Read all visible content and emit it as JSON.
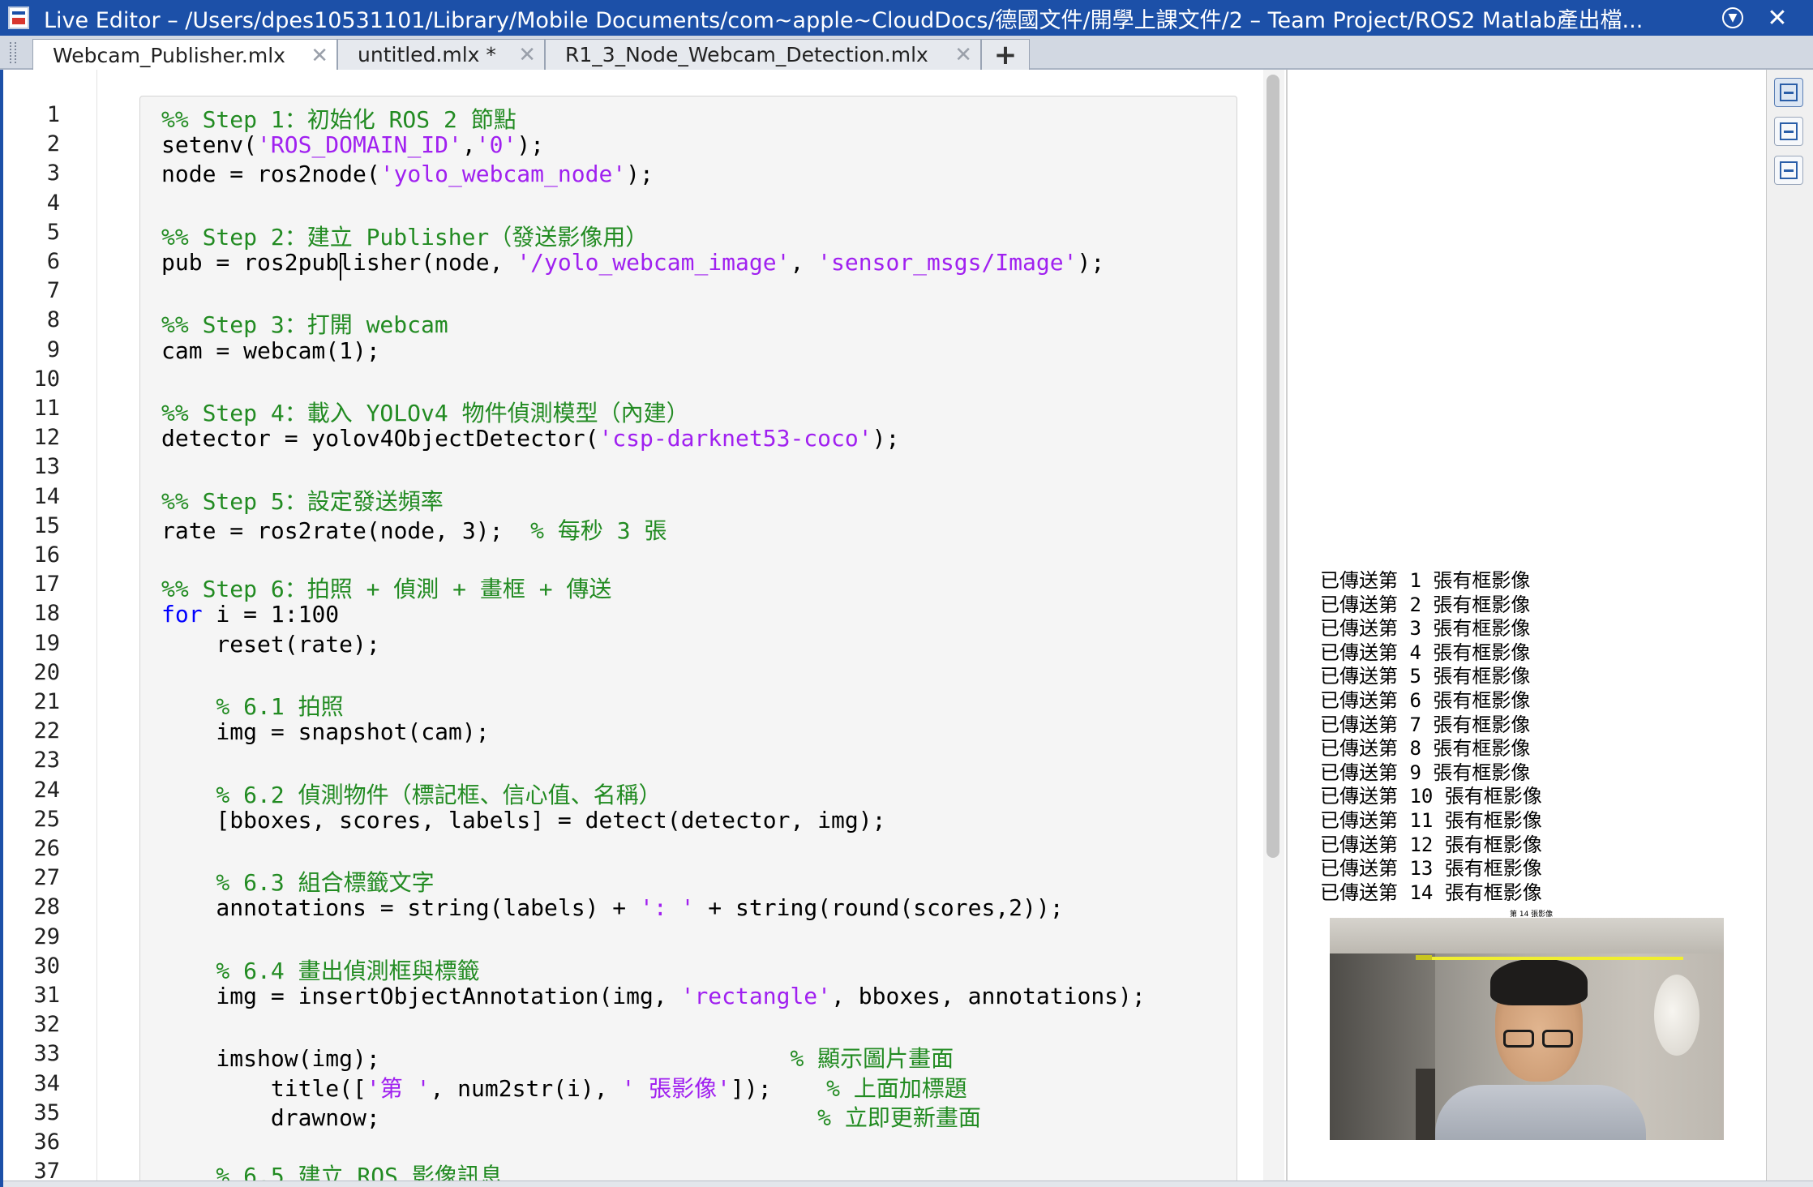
{
  "window": {
    "title": "Live Editor – /Users/dpes10531101/Library/Mobile Documents/com~apple~CloudDocs/德國文件/開學上課文件/2 – Team Project/ROS2 Matlab產出檔...",
    "app_icon": "matlab-live-editor-icon",
    "menu_icon": "circle-chevron-down-icon",
    "close_glyph": "✕"
  },
  "tabs": [
    {
      "label": "Webcam_Publisher.mlx",
      "active": true
    },
    {
      "label": "untitled.mlx *",
      "active": false
    },
    {
      "label": "R1_3_Node_Webcam_Detection.mlx",
      "active": false
    }
  ],
  "tab_close_glyph": "✕",
  "tab_add_glyph": "+",
  "colors": {
    "titlebar": "#1c50a8",
    "comment": "#228b22",
    "string": "#a020f0",
    "keyword": "#0000ff",
    "code_background": "#f5f5f5"
  },
  "code_lines": [
    {
      "n": "1",
      "parts": [
        {
          "t": "%% Step 1：初始化 ROS 2 節點",
          "k": "comment"
        }
      ]
    },
    {
      "n": "2",
      "parts": [
        {
          "t": "setenv(",
          "k": "plain"
        },
        {
          "t": "'ROS_DOMAIN_ID'",
          "k": "string"
        },
        {
          "t": ",",
          "k": "plain"
        },
        {
          "t": "'0'",
          "k": "string"
        },
        {
          "t": ");",
          "k": "plain"
        }
      ]
    },
    {
      "n": "3",
      "parts": [
        {
          "t": "node = ros2node(",
          "k": "plain"
        },
        {
          "t": "'yolo_webcam_node'",
          "k": "string"
        },
        {
          "t": ");",
          "k": "plain"
        }
      ]
    },
    {
      "n": "4",
      "parts": []
    },
    {
      "n": "5",
      "parts": [
        {
          "t": "%% Step 2：建立 Publisher（發送影像用）",
          "k": "comment"
        }
      ]
    },
    {
      "n": "6",
      "parts": [
        {
          "t": "pub = ros2publisher(node, ",
          "k": "plain"
        },
        {
          "t": "'/yolo_webcam_image'",
          "k": "string"
        },
        {
          "t": ", ",
          "k": "plain"
        },
        {
          "t": "'sensor_msgs/Image'",
          "k": "string"
        },
        {
          "t": ");",
          "k": "plain"
        }
      ]
    },
    {
      "n": "7",
      "parts": []
    },
    {
      "n": "8",
      "parts": [
        {
          "t": "%% Step 3：打開 webcam",
          "k": "comment"
        }
      ]
    },
    {
      "n": "9",
      "parts": [
        {
          "t": "cam = webcam(1);",
          "k": "plain"
        }
      ]
    },
    {
      "n": "10",
      "parts": []
    },
    {
      "n": "11",
      "parts": [
        {
          "t": "%% Step 4：載入 YOLOv4 物件偵測模型（內建）",
          "k": "comment"
        }
      ]
    },
    {
      "n": "12",
      "parts": [
        {
          "t": "detector = yolov4ObjectDetector(",
          "k": "plain"
        },
        {
          "t": "'csp-darknet53-coco'",
          "k": "string"
        },
        {
          "t": ");",
          "k": "plain"
        }
      ]
    },
    {
      "n": "13",
      "parts": []
    },
    {
      "n": "14",
      "parts": [
        {
          "t": "%% Step 5：設定發送頻率",
          "k": "comment"
        }
      ]
    },
    {
      "n": "15",
      "parts": [
        {
          "t": "rate = ros2rate(node, 3);  ",
          "k": "plain"
        },
        {
          "t": "% 每秒 3 張",
          "k": "comment"
        }
      ]
    },
    {
      "n": "16",
      "parts": []
    },
    {
      "n": "17",
      "parts": [
        {
          "t": "%% Step 6：拍照 + 偵測 + 畫框 + 傳送",
          "k": "comment"
        }
      ]
    },
    {
      "n": "18",
      "parts": [
        {
          "t": "for",
          "k": "keyword"
        },
        {
          "t": " i = 1:100",
          "k": "plain"
        }
      ]
    },
    {
      "n": "19",
      "parts": [
        {
          "t": "    reset(rate);",
          "k": "plain"
        }
      ]
    },
    {
      "n": "20",
      "parts": []
    },
    {
      "n": "21",
      "parts": [
        {
          "t": "    % 6.1 拍照",
          "k": "comment"
        }
      ]
    },
    {
      "n": "22",
      "parts": [
        {
          "t": "    img = snapshot(cam);",
          "k": "plain"
        }
      ]
    },
    {
      "n": "23",
      "parts": []
    },
    {
      "n": "24",
      "parts": [
        {
          "t": "    % 6.2 偵測物件（標記框、信心值、名稱）",
          "k": "comment"
        }
      ]
    },
    {
      "n": "25",
      "parts": [
        {
          "t": "    [bboxes, scores, labels] = detect(detector, img);",
          "k": "plain"
        }
      ]
    },
    {
      "n": "26",
      "parts": []
    },
    {
      "n": "27",
      "parts": [
        {
          "t": "    % 6.3 組合標籤文字",
          "k": "comment"
        }
      ]
    },
    {
      "n": "28",
      "parts": [
        {
          "t": "    annotations = string(labels) + ",
          "k": "plain"
        },
        {
          "t": "': '",
          "k": "string"
        },
        {
          "t": " + string(round(scores,2));",
          "k": "plain"
        }
      ]
    },
    {
      "n": "29",
      "parts": []
    },
    {
      "n": "30",
      "parts": [
        {
          "t": "    % 6.4 畫出偵測框與標籤",
          "k": "comment"
        }
      ]
    },
    {
      "n": "31",
      "parts": [
        {
          "t": "    img = insertObjectAnnotation(img, ",
          "k": "plain"
        },
        {
          "t": "'rectangle'",
          "k": "string"
        },
        {
          "t": ", bboxes, annotations);",
          "k": "plain"
        }
      ]
    },
    {
      "n": "32",
      "parts": []
    },
    {
      "n": "33",
      "parts": [
        {
          "t": "    imshow(img);                              ",
          "k": "plain"
        },
        {
          "t": "% 顯示圖片畫面",
          "k": "comment"
        }
      ]
    },
    {
      "n": "34",
      "parts": [
        {
          "t": "        title([",
          "k": "plain"
        },
        {
          "t": "'第 '",
          "k": "string"
        },
        {
          "t": ", num2str(i), ",
          "k": "plain"
        },
        {
          "t": "' 張影像'",
          "k": "string"
        },
        {
          "t": "]);    ",
          "k": "plain"
        },
        {
          "t": "% 上面加標題",
          "k": "comment"
        }
      ]
    },
    {
      "n": "35",
      "parts": [
        {
          "t": "        drawnow;                                ",
          "k": "plain"
        },
        {
          "t": "% 立即更新畫面",
          "k": "comment"
        }
      ]
    },
    {
      "n": "36",
      "parts": []
    },
    {
      "n": "37",
      "parts": [
        {
          "t": "    % 6.5 建立 ROS 影像訊息",
          "k": "comment"
        }
      ]
    }
  ],
  "output_lines": [
    "已傳送第 1 張有框影像",
    "已傳送第 2 張有框影像",
    "已傳送第 3 張有框影像",
    "已傳送第 4 張有框影像",
    "已傳送第 5 張有框影像",
    "已傳送第 6 張有框影像",
    "已傳送第 7 張有框影像",
    "已傳送第 8 張有框影像",
    "已傳送第 9 張有框影像",
    "已傳送第 10 張有框影像",
    "已傳送第 11 張有框影像",
    "已傳送第 12 張有框影像",
    "已傳送第 13 張有框影像",
    "已傳送第 14 張有框影像"
  ],
  "figure": {
    "title": "第 14 張影像",
    "image_alt": "webcam-frame-with-detection"
  },
  "view_buttons": [
    {
      "icon": "output-inline-right-icon",
      "selected": true
    },
    {
      "icon": "output-inline-icon",
      "selected": false
    },
    {
      "icon": "hide-code-icon",
      "selected": false
    }
  ]
}
